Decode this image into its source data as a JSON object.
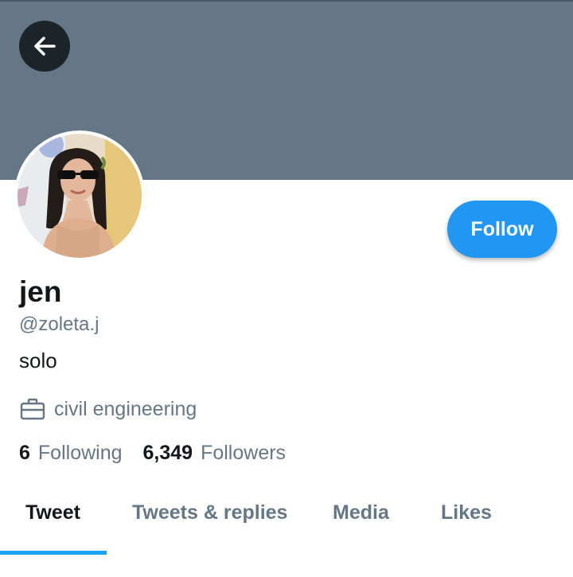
{
  "profile": {
    "display_name": "jen",
    "handle": "@zoleta.j",
    "bio": "solo",
    "work": "civil engineering",
    "following_count": "6",
    "following_label": "Following",
    "followers_count": "6,349",
    "followers_label": "Followers"
  },
  "actions": {
    "follow_label": "Follow",
    "back_icon": "arrow-left-icon"
  },
  "tabs": [
    {
      "label": "Tweet",
      "active": true
    },
    {
      "label": "Tweets & replies",
      "active": false
    },
    {
      "label": "Media",
      "active": false
    },
    {
      "label": "Likes",
      "active": false
    }
  ],
  "colors": {
    "banner": "#657786",
    "accent": "#1da1f2",
    "follow_button": "#2196f3",
    "secondary_text": "#657786",
    "primary_text": "#14171a"
  }
}
